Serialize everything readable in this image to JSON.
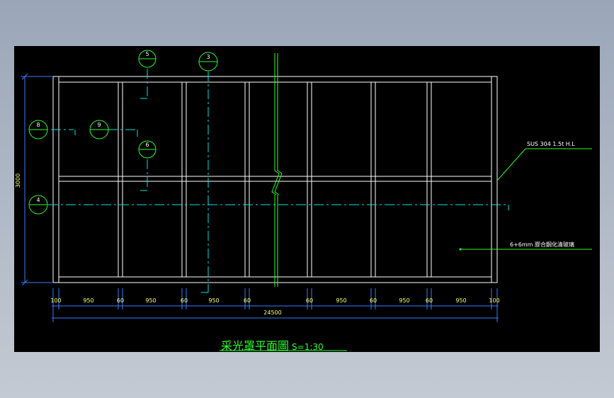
{
  "drawing": {
    "title": "采光罩平面圖",
    "scale": "S=1:30",
    "material_note_1": "SUS 304 1.5t H.L",
    "material_note_2": "6+6mm 膠合鋼化清玻璃",
    "overall_height": "3000",
    "overall_width": "24500",
    "dim_labels": [
      "100",
      "950",
      "60",
      "950",
      "60",
      "950",
      "60",
      "60",
      "950",
      "60",
      "950",
      "60",
      "950",
      "100"
    ],
    "callouts": [
      "5",
      "3",
      "8",
      "9",
      "6",
      "4"
    ]
  },
  "colors": {
    "background": "#000000",
    "frame": "#ffffff",
    "dimension": "#3a7bff",
    "center_line": "#00e5e5",
    "annotation": "#2cff2c",
    "tag": "#ffff66"
  }
}
